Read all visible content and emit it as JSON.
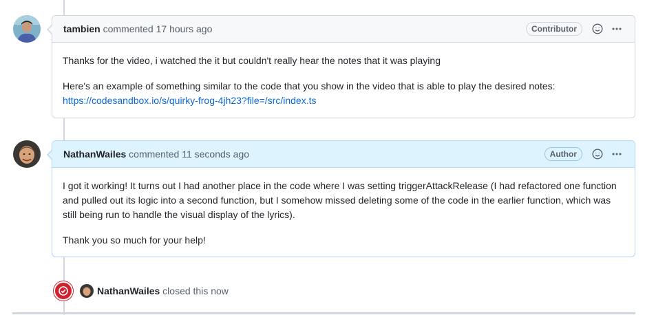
{
  "comments": [
    {
      "author": "tambien",
      "action": "commented",
      "timestamp": "17 hours ago",
      "badge": "Contributor",
      "paragraph1": "Thanks for the video, i watched the it but couldn't really hear the notes that it was playing",
      "paragraph2": "Here's an example of something similar to the code that you show in the video that is able to play the desired notes:",
      "link": "https://codesandbox.io/s/quirky-frog-4jh23?file=/src/index.ts"
    },
    {
      "author": "NathanWailes",
      "action": "commented",
      "timestamp": "11 seconds ago",
      "badge": "Author",
      "paragraph1": "I got it working! It turns out I had another place in the code where I was setting triggerAttackRelease (I had refactored one function and pulled out its logic into a second function, but I somehow missed deleting some of the code in the earlier function, which was still being run to handle the visual display of the lyrics).",
      "paragraph2": "Thank you so much for your help!"
    }
  ],
  "closed_event": {
    "user": "NathanWailes",
    "text": "closed this now"
  },
  "colors": {
    "closed_red": "#cf222e",
    "link_blue": "#0969da",
    "author_header_bg": "#ddf4ff"
  },
  "icons": {
    "reaction": "smiley-icon",
    "menu": "kebab-horizontal-icon",
    "closed": "issue-closed-icon"
  }
}
